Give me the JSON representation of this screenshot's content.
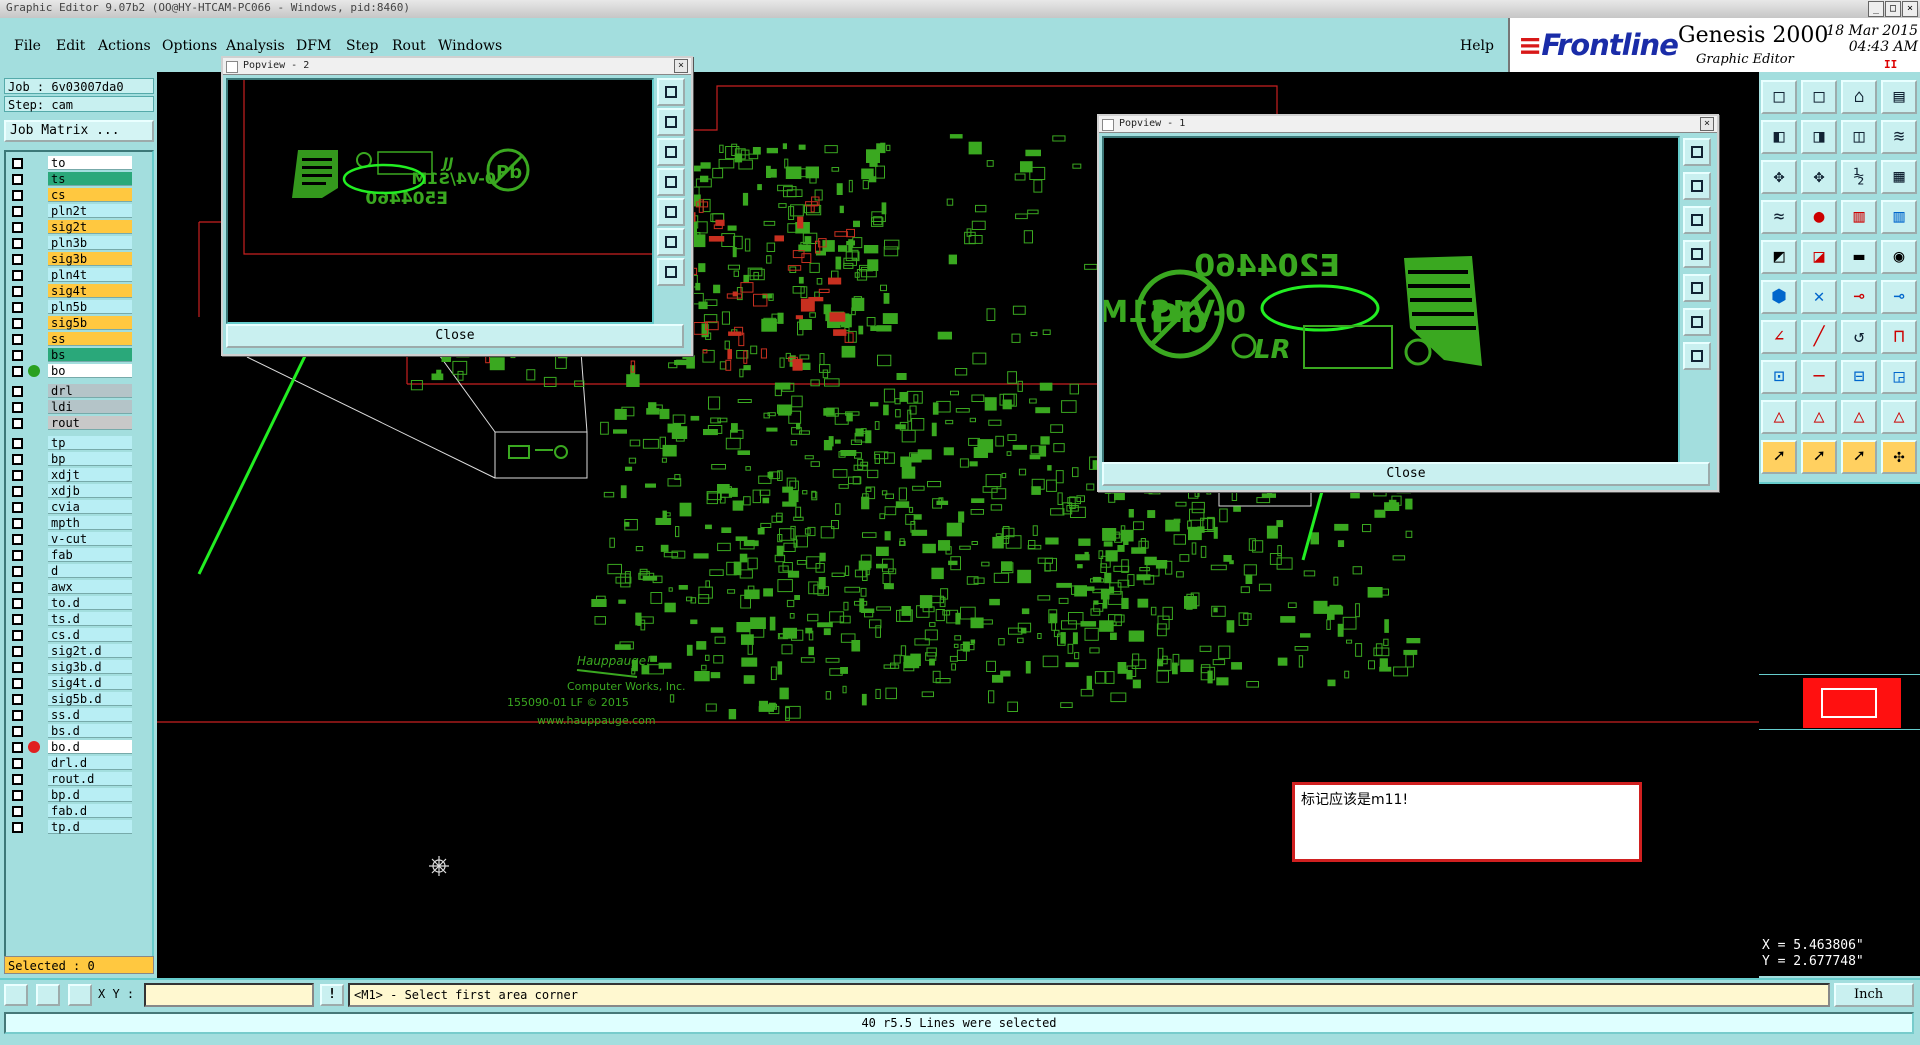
{
  "window": {
    "title": "Graphic Editor 9.07b2 (OO@HY-HTCAM-PC066 - Windows, pid:8460)",
    "controls": [
      "_",
      "□",
      "×"
    ]
  },
  "menu": {
    "items": [
      "File",
      "Edit",
      "Actions",
      "Options",
      "Analysis",
      "DFM",
      "Step",
      "Rout",
      "Windows"
    ],
    "help": "Help"
  },
  "brand": {
    "logo": "Frontline",
    "product": "Genesis 2000",
    "subtitle": "Graphic Editor",
    "date": "18 Mar 2015",
    "time": "04:43 AM",
    "stop_glyph": "II"
  },
  "job": {
    "job_label": "Job : 6v03007da0",
    "step_label": "Step: cam",
    "matrix_button": "Job Matrix ..."
  },
  "layers": [
    {
      "name": "to",
      "bg": "#ffffff"
    },
    {
      "name": "ts",
      "bg": "#2aa87a"
    },
    {
      "name": "cs",
      "bg": "#ffc840"
    },
    {
      "name": "pln2t",
      "bg": "#b8eef4"
    },
    {
      "name": "sig2t",
      "bg": "#ffc840"
    },
    {
      "name": "pln3b",
      "bg": "#b8eef4"
    },
    {
      "name": "sig3b",
      "bg": "#ffc840"
    },
    {
      "name": "pln4t",
      "bg": "#b8eef4"
    },
    {
      "name": "sig4t",
      "bg": "#ffc840"
    },
    {
      "name": "pln5b",
      "bg": "#b8eef4"
    },
    {
      "name": "sig5b",
      "bg": "#ffc840"
    },
    {
      "name": "ss",
      "bg": "#ffc840"
    },
    {
      "name": "bs",
      "bg": "#2aa87a"
    },
    {
      "name": "bo",
      "bg": "#ffffff",
      "dot": "#2aa020"
    },
    {
      "name": "drl",
      "bg": "#b4c4c8"
    },
    {
      "name": "ldi",
      "bg": "#b4c4c8"
    },
    {
      "name": "rout",
      "bg": "#c8c8c8"
    },
    {
      "name": "tp",
      "bg": "#b8eef4"
    },
    {
      "name": "bp",
      "bg": "#b8eef4"
    },
    {
      "name": "xdjt",
      "bg": "#b8eef4"
    },
    {
      "name": "xdjb",
      "bg": "#b8eef4"
    },
    {
      "name": "cvia",
      "bg": "#b8eef4"
    },
    {
      "name": "mpth",
      "bg": "#b8eef4"
    },
    {
      "name": "v-cut",
      "bg": "#b8eef4"
    },
    {
      "name": "fab",
      "bg": "#b8eef4"
    },
    {
      "name": "d",
      "bg": "#b8eef4"
    },
    {
      "name": "awx",
      "bg": "#b8eef4"
    },
    {
      "name": "to.d",
      "bg": "#b8eef4"
    },
    {
      "name": "ts.d",
      "bg": "#b8eef4"
    },
    {
      "name": "cs.d",
      "bg": "#b8eef4"
    },
    {
      "name": "sig2t.d",
      "bg": "#b8eef4"
    },
    {
      "name": "sig3b.d",
      "bg": "#b8eef4"
    },
    {
      "name": "sig4t.d",
      "bg": "#b8eef4"
    },
    {
      "name": "sig5b.d",
      "bg": "#b8eef4"
    },
    {
      "name": "ss.d",
      "bg": "#b8eef4"
    },
    {
      "name": "bs.d",
      "bg": "#b8eef4"
    },
    {
      "name": "bo.d",
      "bg": "#ffffff",
      "dot": "#e02020"
    },
    {
      "name": "drl.d",
      "bg": "#b8eef4"
    },
    {
      "name": "rout.d",
      "bg": "#b8eef4"
    },
    {
      "name": "bp.d",
      "bg": "#b8eef4"
    },
    {
      "name": "fab.d",
      "bg": "#b8eef4"
    },
    {
      "name": "tp.d",
      "bg": "#b8eef4"
    }
  ],
  "selected": "Selected : 0",
  "popview2": {
    "title": "Popview - 2",
    "close": "Close",
    "marking_lines": [
      "0-V4/S1M",
      "E504460"
    ],
    "marking_pb": "Pb"
  },
  "popview1": {
    "title": "Popview - 1",
    "close": "Close",
    "marking_lines": [
      "E204460",
      "0-V4S1M"
    ],
    "marking_pb": "Pb"
  },
  "board_text": [
    "Hauppauge!",
    "Computer Works, Inc.",
    "155090-01 LF © 2015",
    "www.hauppauge.com"
  ],
  "note": "标记应该是m11!",
  "coords": {
    "x": "X = 5.463806\"",
    "y": "Y = 2.677748\""
  },
  "command": {
    "xy_label": "X Y :",
    "xy_value": "",
    "prompt_icon": "!",
    "prompt": "<M1> - Select first area corner",
    "unit": "Inch"
  },
  "status": "40 r5.5 Lines were selected",
  "colors": {
    "accent": "#a3dede",
    "board_green": "#3aa820",
    "frame_red": "#c82020",
    "annotation_green": "#22ee22"
  }
}
